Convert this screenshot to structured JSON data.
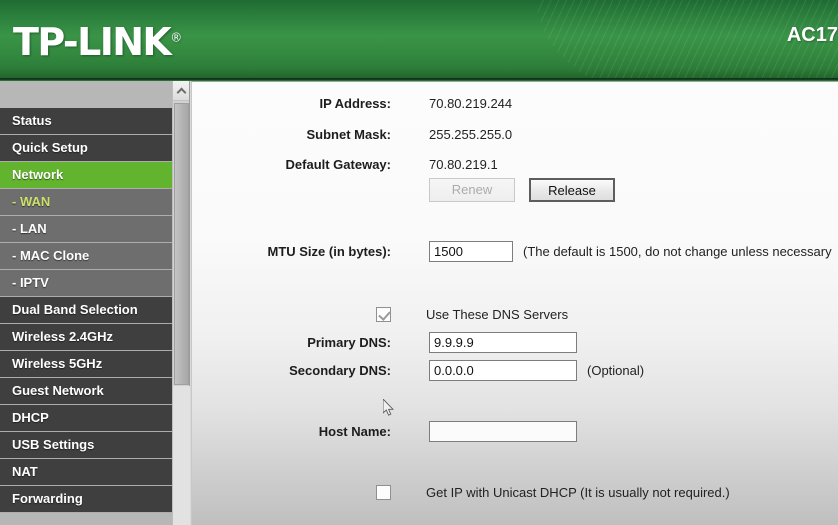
{
  "header": {
    "brand": "TP-LINK",
    "registered_mark": "®",
    "model": "AC17"
  },
  "sidebar": {
    "items": [
      {
        "label": "Status",
        "type": "main",
        "state": "normal"
      },
      {
        "label": "Quick Setup",
        "type": "main",
        "state": "normal"
      },
      {
        "label": "Network",
        "type": "main",
        "state": "active"
      },
      {
        "label": "- WAN",
        "type": "sub",
        "state": "active"
      },
      {
        "label": "- LAN",
        "type": "sub",
        "state": "normal"
      },
      {
        "label": "- MAC Clone",
        "type": "sub",
        "state": "normal"
      },
      {
        "label": "- IPTV",
        "type": "sub",
        "state": "normal"
      },
      {
        "label": "Dual Band Selection",
        "type": "main",
        "state": "normal"
      },
      {
        "label": "Wireless 2.4GHz",
        "type": "main",
        "state": "normal"
      },
      {
        "label": "Wireless 5GHz",
        "type": "main",
        "state": "normal"
      },
      {
        "label": "Guest Network",
        "type": "main",
        "state": "normal"
      },
      {
        "label": "DHCP",
        "type": "main",
        "state": "normal"
      },
      {
        "label": "USB Settings",
        "type": "main",
        "state": "normal"
      },
      {
        "label": "NAT",
        "type": "main",
        "state": "normal"
      },
      {
        "label": "Forwarding",
        "type": "main",
        "state": "normal"
      }
    ]
  },
  "main": {
    "ip_address": {
      "label": "IP Address:",
      "value": "70.80.219.244"
    },
    "subnet_mask": {
      "label": "Subnet Mask:",
      "value": "255.255.255.0"
    },
    "default_gateway": {
      "label": "Default Gateway:",
      "value": "70.80.219.1"
    },
    "renew_button": {
      "label": "Renew",
      "enabled": false
    },
    "release_button": {
      "label": "Release",
      "enabled": true
    },
    "mtu": {
      "label": "MTU Size (in bytes):",
      "value": "1500",
      "hint": "(The default is 1500, do not change unless necessary"
    },
    "use_dns": {
      "label": "Use These DNS Servers",
      "checked": true
    },
    "primary_dns": {
      "label": "Primary DNS:",
      "value": "9.9.9.9"
    },
    "secondary_dns": {
      "label": "Secondary DNS:",
      "value": "0.0.0.0",
      "note": "(Optional)"
    },
    "host_name": {
      "label": "Host Name:",
      "value": ""
    },
    "unicast_dhcp": {
      "label": "Get IP with Unicast DHCP (It is usually not required.)",
      "checked": false
    }
  },
  "colors": {
    "brand_green": "#2a7d3c",
    "active_menu_green": "#62b32e",
    "active_submenu_text": "#cfe06a",
    "menu_bg": "#3f3f3f",
    "submenu_bg": "#6e6e6e"
  }
}
